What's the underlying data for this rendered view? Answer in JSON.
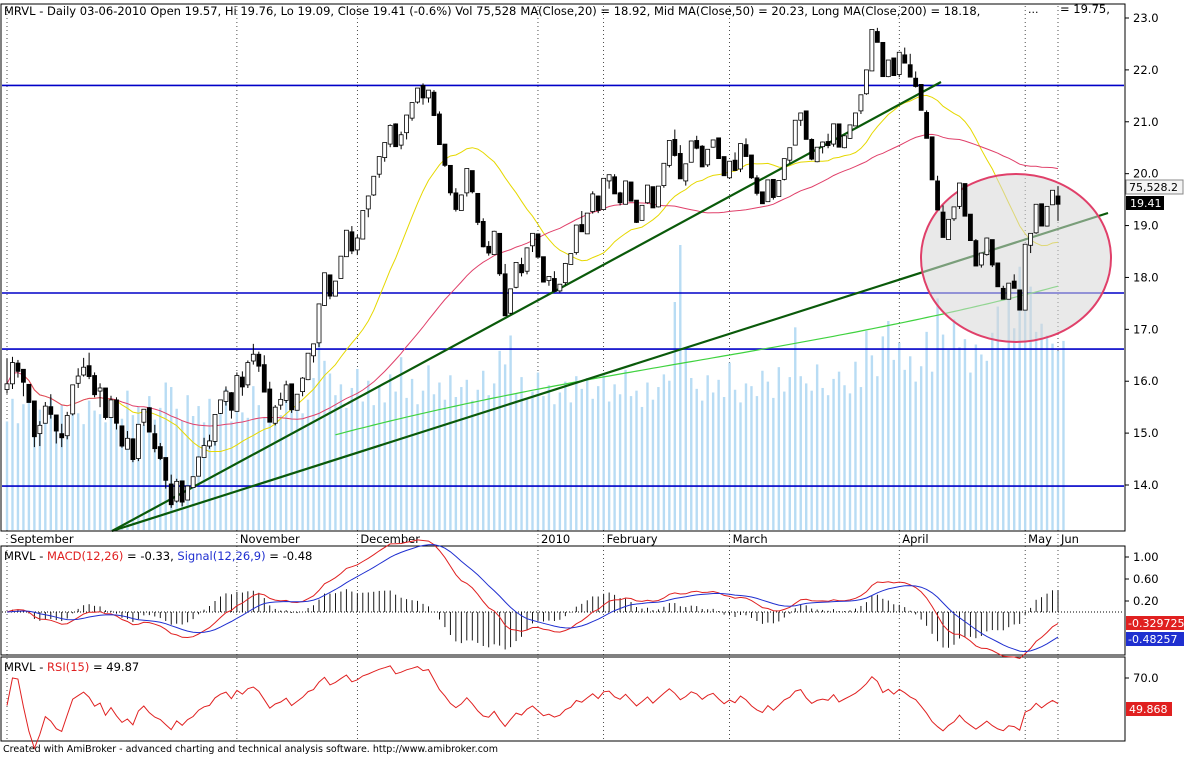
{
  "header": {
    "symbol": "MRVL",
    "main_text": "MRVL - Daily 03-06-2010 Open 19.57, Hi 19.76, Lo 19.09, Close 19.41 (-0.6%) Vol 75,528",
    "ma20": "MA(Close,20)",
    "ma20_value": " = 18.92, ",
    "ma50": "Mid MA(Close,50)",
    "ma50_value": " = 20.23, ",
    "ma200": "Long MA(Close,200)",
    "ma200_value": " = 18.18,",
    "right_value": "= 19.75,"
  },
  "footer": "Created with AmiBroker - advanced charting and technical analysis software. http://www.amibroker.com",
  "colors": {
    "ma20": "#e6d800",
    "ma50": "#e0406a",
    "ma200": "#3fd23f",
    "macd": "#e02020",
    "signal": "#1f2fd0",
    "rsi": "#e02020",
    "volume": "#b8dcf4",
    "hline": "#0000c8",
    "trend": "#0a5a0a"
  },
  "chart_data": {
    "type": "candlestick",
    "y_axis": [
      "23.0",
      "22.0",
      "21.0",
      "20.0",
      "19.0",
      "18.0",
      "17.0",
      "16.0",
      "15.0",
      "14.0"
    ],
    "x_labels": [
      "September",
      "November",
      "December",
      "2010",
      "February",
      "March",
      "April",
      "May",
      "Jun"
    ],
    "horizontal_levels": [
      21.7,
      17.7,
      16.62,
      13.98
    ],
    "price_tags": {
      "volume": "75,528.2",
      "close": "19.41"
    },
    "ohlc": [
      [
        15.84,
        16.44,
        15.76,
        15.95
      ],
      [
        15.95,
        16.47,
        15.85,
        16.36
      ],
      [
        16.35,
        16.41,
        16.07,
        16.19
      ],
      [
        16.23,
        16.2,
        15.71,
        15.98
      ],
      [
        15.94,
        15.92,
        15.61,
        15.59
      ],
      [
        15.62,
        15.6,
        14.73,
        14.93
      ],
      [
        14.99,
        15.23,
        14.75,
        15.15
      ],
      [
        15.19,
        15.6,
        15.35,
        15.52
      ],
      [
        15.51,
        15.75,
        15.28,
        15.36
      ],
      [
        15.35,
        15.31,
        14.8,
        15.04
      ],
      [
        14.99,
        15.18,
        14.73,
        14.91
      ],
      [
        14.95,
        15.41,
        14.88,
        15.34
      ],
      [
        15.37,
        15.92,
        15.34,
        15.93
      ],
      [
        15.96,
        16.25,
        15.87,
        16.1
      ],
      [
        16.12,
        16.45,
        16.09,
        16.27
      ],
      [
        16.3,
        16.55,
        16.04,
        16.09
      ],
      [
        16.11,
        16.17,
        15.69,
        15.74
      ],
      [
        15.81,
        15.96,
        15.5,
        15.87
      ],
      [
        15.87,
        15.84,
        15.26,
        15.3
      ],
      [
        15.3,
        15.72,
        15.29,
        15.64
      ],
      [
        15.64,
        15.69,
        15.07,
        15.19
      ],
      [
        15.14,
        15.12,
        14.72,
        14.75
      ],
      [
        14.69,
        15.04,
        14.7,
        14.9
      ],
      [
        14.89,
        14.9,
        14.44,
        14.49
      ],
      [
        14.51,
        15.16,
        14.46,
        15.17
      ],
      [
        15.21,
        15.38,
        15.14,
        15.46
      ],
      [
        15.49,
        15.5,
        15.15,
        15.02
      ],
      [
        14.99,
        15.16,
        14.63,
        14.7
      ],
      [
        14.74,
        14.81,
        14.48,
        14.51
      ],
      [
        14.53,
        14.39,
        13.93,
        14.09
      ],
      [
        14.02,
        14.2,
        13.56,
        13.62
      ],
      [
        13.69,
        14.12,
        13.66,
        14.07
      ],
      [
        14.08,
        14.01,
        13.59,
        13.67
      ],
      [
        13.71,
        13.97,
        13.71,
        13.98
      ],
      [
        13.95,
        14.16,
        13.94,
        14.16
      ],
      [
        14.17,
        14.55,
        14.2,
        14.54
      ],
      [
        14.53,
        14.91,
        14.53,
        14.76
      ],
      [
        14.75,
        14.97,
        14.7,
        14.85
      ],
      [
        14.84,
        15.33,
        14.76,
        15.36
      ],
      [
        15.38,
        15.53,
        15.37,
        15.64
      ],
      [
        15.61,
        15.9,
        15.53,
        15.81
      ],
      [
        15.78,
        15.79,
        15.28,
        15.44
      ],
      [
        15.42,
        16.17,
        15.42,
        16.11
      ],
      [
        16.08,
        16.19,
        15.72,
        15.89
      ],
      [
        15.93,
        16.4,
        15.87,
        16.36
      ],
      [
        16.39,
        16.72,
        16.32,
        16.52
      ],
      [
        16.52,
        16.57,
        16.18,
        16.29
      ],
      [
        16.32,
        16.5,
        15.8,
        15.79
      ],
      [
        15.85,
        15.99,
        15.21,
        15.21
      ],
      [
        15.19,
        15.54,
        15.15,
        15.5
      ],
      [
        15.54,
        15.78,
        15.45,
        15.65
      ],
      [
        15.63,
        16.01,
        15.58,
        15.93
      ],
      [
        15.95,
        15.87,
        15.39,
        15.45
      ],
      [
        15.44,
        15.68,
        15.45,
        15.75
      ],
      [
        15.8,
        16.08,
        15.71,
        16.06
      ],
      [
        16.03,
        16.48,
        16.02,
        16.54
      ],
      [
        16.49,
        16.72,
        16.36,
        16.72
      ],
      [
        16.74,
        17.42,
        16.66,
        17.49
      ],
      [
        17.46,
        18.02,
        17.45,
        18.09
      ],
      [
        18.05,
        18.03,
        17.58,
        17.64
      ],
      [
        17.64,
        17.85,
        17.64,
        17.93
      ],
      [
        17.98,
        18.35,
        17.98,
        18.41
      ],
      [
        18.4,
        18.76,
        18.43,
        18.91
      ],
      [
        18.88,
        18.99,
        18.45,
        18.51
      ],
      [
        18.53,
        18.82,
        18.43,
        18.76
      ],
      [
        18.74,
        19.18,
        18.76,
        19.29
      ],
      [
        19.32,
        19.58,
        19.16,
        19.57
      ],
      [
        19.59,
        19.86,
        19.57,
        19.95
      ],
      [
        19.99,
        20.25,
        19.92,
        20.33
      ],
      [
        20.31,
        20.55,
        20.23,
        20.6
      ],
      [
        20.57,
        20.95,
        20.51,
        20.93
      ],
      [
        20.96,
        20.97,
        20.53,
        20.52
      ],
      [
        20.55,
        20.81,
        20.47,
        20.75
      ],
      [
        20.79,
        21.12,
        20.66,
        21.13
      ],
      [
        21.07,
        21.29,
        21.02,
        21.37
      ],
      [
        21.38,
        21.56,
        21.35,
        21.65
      ],
      [
        21.7,
        21.74,
        21.33,
        21.46
      ],
      [
        21.46,
        21.54,
        21.37,
        21.61
      ],
      [
        21.57,
        21.61,
        21.11,
        21.12
      ],
      [
        21.15,
        21.2,
        20.57,
        20.56
      ],
      [
        20.57,
        20.57,
        20.13,
        20.16
      ],
      [
        20.16,
        20.04,
        19.58,
        19.63
      ],
      [
        19.63,
        19.72,
        19.27,
        19.31
      ],
      [
        19.29,
        19.6,
        19.31,
        19.59
      ],
      [
        19.63,
        20.1,
        19.56,
        20.1
      ],
      [
        20.06,
        20.03,
        19.62,
        19.65
      ],
      [
        19.62,
        19.46,
        19.01,
        19.06
      ],
      [
        19.08,
        19.14,
        18.58,
        18.59
      ],
      [
        18.6,
        18.7,
        18.42,
        18.47
      ],
      [
        18.44,
        18.9,
        18.46,
        18.89
      ],
      [
        18.85,
        18.72,
        18.03,
        18.07
      ],
      [
        18.07,
        18.26,
        17.28,
        17.26
      ],
      [
        17.31,
        17.72,
        17.29,
        17.78
      ],
      [
        17.81,
        18.2,
        17.79,
        18.29
      ],
      [
        18.25,
        18.38,
        18.02,
        18.09
      ],
      [
        18.12,
        18.58,
        18.06,
        18.57
      ],
      [
        18.61,
        18.84,
        18.49,
        18.85
      ],
      [
        18.84,
        18.77,
        18.38,
        18.39
      ],
      [
        18.4,
        18.31,
        17.93,
        17.91
      ],
      [
        17.94,
        18.01,
        17.84,
        18.02
      ],
      [
        17.98,
        18.12,
        17.74,
        17.73
      ],
      [
        17.74,
        17.83,
        17.71,
        17.87
      ],
      [
        17.9,
        18.28,
        17.85,
        18.27
      ],
      [
        18.25,
        18.42,
        18.28,
        18.46
      ],
      [
        18.48,
        18.99,
        18.44,
        19.01
      ],
      [
        19.02,
        19.28,
        18.89,
        18.88
      ],
      [
        18.84,
        19.16,
        18.88,
        19.24
      ],
      [
        19.27,
        19.66,
        19.23,
        19.61
      ],
      [
        19.57,
        19.58,
        19.24,
        19.29
      ],
      [
        19.31,
        19.86,
        19.32,
        19.91
      ],
      [
        19.86,
        19.95,
        19.71,
        19.98
      ],
      [
        19.94,
        19.99,
        19.63,
        19.61
      ],
      [
        19.63,
        19.65,
        19.39,
        19.44
      ],
      [
        19.41,
        19.76,
        19.42,
        19.86
      ],
      [
        19.84,
        19.75,
        19.51,
        19.47
      ],
      [
        19.49,
        19.43,
        19.05,
        19.06
      ],
      [
        19.1,
        19.34,
        19.13,
        19.39
      ],
      [
        19.44,
        19.71,
        19.42,
        19.78
      ],
      [
        19.75,
        19.73,
        19.38,
        19.34
      ],
      [
        19.36,
        19.72,
        19.35,
        19.76
      ],
      [
        19.77,
        20.18,
        19.73,
        20.2
      ],
      [
        20.16,
        20.61,
        20.12,
        20.64
      ],
      [
        20.66,
        20.85,
        20.33,
        20.35
      ],
      [
        20.39,
        20.55,
        19.92,
        19.9
      ],
      [
        19.86,
        20.12,
        19.77,
        20.19
      ],
      [
        20.22,
        20.55,
        20.22,
        20.63
      ],
      [
        20.64,
        20.73,
        20.47,
        20.49
      ],
      [
        20.53,
        20.55,
        20.14,
        20.13
      ],
      [
        20.17,
        20.41,
        20.13,
        20.47
      ],
      [
        20.51,
        20.62,
        20.5,
        20.65
      ],
      [
        20.69,
        20.67,
        20.37,
        20.29
      ],
      [
        20.33,
        20.33,
        19.97,
        19.96
      ],
      [
        19.92,
        20.21,
        19.9,
        20.24
      ],
      [
        20.26,
        20.41,
        20.07,
        20.06
      ],
      [
        20.09,
        20.58,
        20.03,
        20.58
      ],
      [
        20.56,
        20.68,
        20.37,
        20.33
      ],
      [
        20.36,
        20.33,
        19.9,
        19.92
      ],
      [
        19.92,
        19.97,
        19.58,
        19.62
      ],
      [
        19.65,
        19.65,
        19.47,
        19.42
      ],
      [
        19.46,
        19.78,
        19.47,
        19.88
      ],
      [
        19.89,
        19.84,
        19.5,
        19.54
      ],
      [
        19.56,
        19.81,
        19.57,
        19.87
      ],
      [
        19.89,
        20.28,
        19.87,
        20.29
      ],
      [
        20.26,
        20.5,
        20.2,
        20.5
      ],
      [
        20.55,
        20.94,
        20.55,
        21.03
      ],
      [
        21.03,
        21.17,
        20.92,
        21.17
      ],
      [
        21.21,
        21.04,
        20.66,
        20.66
      ],
      [
        20.66,
        20.68,
        20.26,
        20.28
      ],
      [
        20.23,
        20.48,
        20.22,
        20.51
      ],
      [
        20.52,
        20.62,
        20.39,
        20.61
      ],
      [
        20.62,
        20.77,
        20.49,
        20.54
      ],
      [
        20.57,
        20.89,
        20.52,
        20.96
      ],
      [
        20.96,
        20.84,
        20.57,
        20.51
      ],
      [
        20.5,
        20.71,
        20.49,
        20.73
      ],
      [
        20.68,
        20.86,
        20.67,
        20.94
      ],
      [
        20.92,
        21.08,
        20.92,
        21.17
      ],
      [
        21.21,
        21.34,
        21.15,
        21.52
      ],
      [
        21.54,
        21.9,
        21.52,
        22.0
      ],
      [
        21.98,
        22.61,
        22.01,
        22.78
      ],
      [
        22.74,
        22.81,
        22.54,
        22.53
      ],
      [
        22.53,
        22.19,
        21.87,
        21.87
      ],
      [
        21.87,
        22.15,
        21.86,
        22.19
      ],
      [
        22.23,
        22.12,
        21.91,
        21.89
      ],
      [
        21.91,
        22.34,
        21.86,
        22.34
      ],
      [
        22.29,
        22.43,
        22.18,
        22.13
      ],
      [
        22.1,
        22.31,
        21.88,
        21.86
      ],
      [
        21.84,
        21.97,
        21.66,
        21.68
      ],
      [
        21.72,
        21.71,
        21.23,
        21.22
      ],
      [
        21.18,
        21.22,
        20.71,
        20.68
      ],
      [
        20.71,
        20.69,
        19.9,
        19.88
      ],
      [
        19.86,
        19.96,
        19.32,
        19.3
      ],
      [
        19.26,
        19.39,
        18.77,
        18.77
      ],
      [
        18.73,
        19.1,
        18.73,
        19.12
      ],
      [
        19.13,
        19.35,
        19.09,
        19.36
      ],
      [
        19.37,
        19.81,
        19.32,
        19.82
      ],
      [
        19.81,
        19.7,
        19.21,
        19.18
      ],
      [
        19.22,
        19.12,
        18.71,
        18.71
      ],
      [
        18.71,
        18.74,
        18.23,
        18.22
      ],
      [
        18.24,
        18.45,
        18.19,
        18.47
      ],
      [
        18.44,
        18.77,
        18.42,
        18.76
      ],
      [
        18.73,
        18.68,
        18.2,
        18.24
      ],
      [
        18.28,
        18.15,
        17.85,
        17.82
      ],
      [
        17.79,
        17.84,
        17.6,
        17.58
      ],
      [
        17.58,
        17.87,
        17.6,
        17.89
      ],
      [
        17.93,
        18.06,
        17.79,
        17.79
      ],
      [
        17.76,
        17.74,
        17.39,
        17.37
      ],
      [
        17.37,
        18.37,
        17.45,
        18.64
      ],
      [
        18.62,
        18.83,
        18.47,
        18.85
      ],
      [
        18.86,
        19.3,
        18.84,
        19.41
      ],
      [
        19.42,
        19.35,
        19.0,
        18.99
      ],
      [
        18.99,
        19.34,
        18.98,
        19.37
      ],
      [
        19.4,
        19.61,
        19.42,
        19.68
      ],
      [
        19.57,
        19.76,
        19.09,
        19.41
      ]
    ],
    "volume": [
      12000,
      14500,
      11800,
      13900,
      15200,
      12600,
      13300,
      12100,
      14700,
      11500,
      13800,
      12400,
      15100,
      12900,
      11700,
      14300,
      13200,
      12800,
      11900,
      14600,
      13100,
      12300,
      15400,
      12700,
      13600,
      11600,
      14800,
      12200,
      13500,
      16300,
      15800,
      13400,
      12100,
      14900,
      12600,
      13700,
      11900,
      14500,
      12800,
      13300,
      15600,
      12000,
      14100,
      13000,
      12400,
      15900,
      13800,
      12500,
      14200,
      13100,
      12700,
      14700,
      15200,
      13600,
      12900,
      14400,
      16800,
      21000,
      18700,
      17300,
      14900,
      16100,
      13500,
      15700,
      17800,
      14200,
      16500,
      13800,
      15900,
      14100,
      17200,
      15300,
      19100,
      14600,
      16700,
      13900,
      15400,
      18200,
      15000,
      16300,
      14400,
      17100,
      14700,
      15800,
      16600,
      14300,
      15500,
      17600,
      14900,
      16200,
      19800,
      18300,
      21500,
      15100,
      16900,
      14600,
      15300,
      17400,
      14800,
      16000,
      13900,
      15200,
      16400,
      14100,
      17000,
      15600,
      16800,
      14500,
      15900,
      17300,
      14200,
      16100,
      15000,
      17700,
      14800,
      15400,
      13600,
      16300,
      14400,
      15800,
      17200,
      16500,
      25200,
      31500,
      19900,
      16800,
      15600,
      14300,
      17100,
      15200,
      16600,
      14700,
      18500,
      15500,
      14100,
      16200,
      15900,
      14800,
      17600,
      16400,
      14600,
      18000,
      15300,
      16900,
      22400,
      17000,
      16200,
      15400,
      18300,
      15700,
      14900,
      16700,
      17500,
      16000,
      15100,
      18600,
      15800,
      22000,
      19300,
      17000,
      21400,
      23100,
      18800,
      20700,
      17700,
      19200,
      16400,
      18100,
      21900,
      17500,
      25600,
      21600,
      19900,
      23300,
      20200,
      21100,
      17400,
      20500,
      19400,
      18700,
      21800,
      24700,
      20100,
      27000,
      22300,
      29100,
      24300,
      26900,
      21900,
      22800,
      21500,
      20600,
      19800,
      20900
    ],
    "macd_y_axis": [
      "1.00",
      "0.60",
      "0.20"
    ],
    "macd_tags": {
      "macd": "-0.329725",
      "signal": "-0.48257"
    },
    "rsi_y_axis": [
      "70.0"
    ],
    "rsi_tag": "49.868"
  },
  "panels": {
    "macd": {
      "label_prefix": "MRVL - ",
      "macd_label": "MACD(12,26)",
      "macd_value": " = -0.33, ",
      "signal_label": "Signal(12,26,9)",
      "signal_value": " = -0.48"
    },
    "rsi": {
      "label_prefix": "MRVL - ",
      "rsi_label": "RSI(15)",
      "rsi_value": " = 49.87"
    }
  }
}
